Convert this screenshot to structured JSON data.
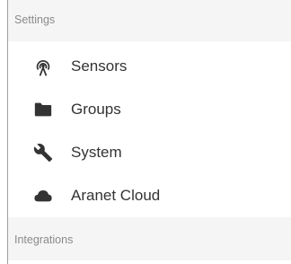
{
  "sidebar": {
    "sections": [
      {
        "title": "Settings"
      },
      {
        "title": "Integrations"
      }
    ],
    "items": [
      {
        "label": "Sensors",
        "icon": "sensor-antenna-icon"
      },
      {
        "label": "Groups",
        "icon": "folder-icon"
      },
      {
        "label": "System",
        "icon": "wrench-icon"
      },
      {
        "label": "Aranet Cloud",
        "icon": "cloud-icon"
      }
    ]
  },
  "colors": {
    "header_bg": "#f5f5f5",
    "header_text": "#8a8a8a",
    "item_text": "#333333",
    "icon": "#333333",
    "border": "#9e9e9e"
  }
}
